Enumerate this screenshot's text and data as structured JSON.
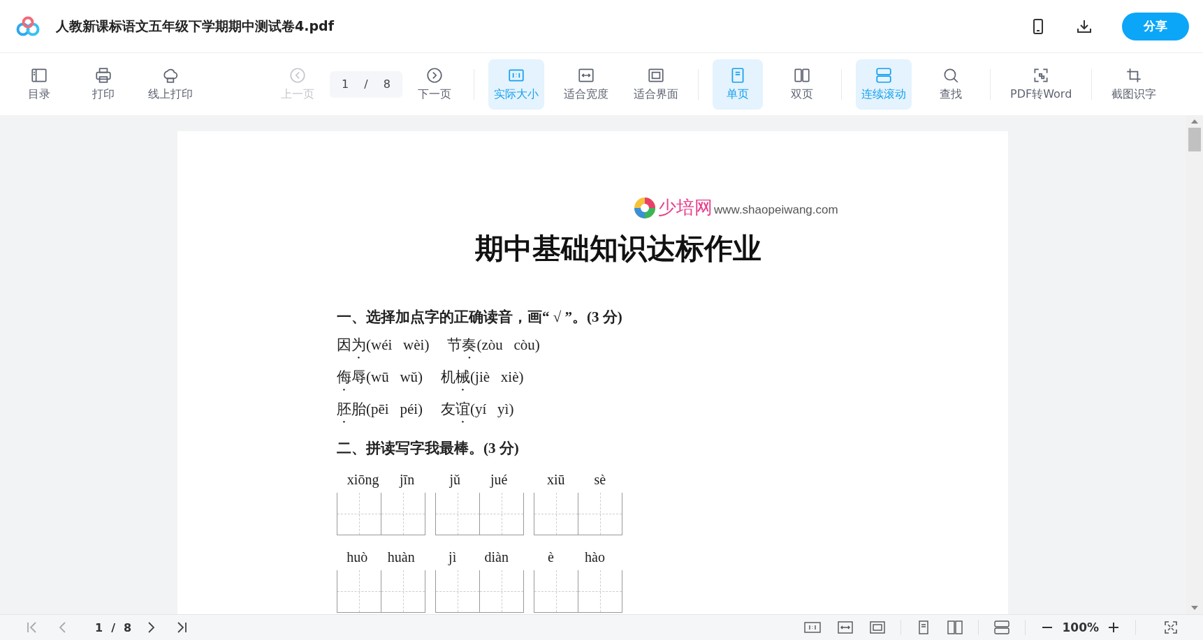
{
  "header": {
    "title": "人教新课标语文五年级下学期期中测试卷4.pdf",
    "share_button": "分享"
  },
  "toolbar": {
    "items": [
      {
        "label": "目录",
        "selected": false,
        "disabled": false,
        "separator_before": false
      },
      {
        "label": "打印",
        "selected": false,
        "disabled": false,
        "separator_before": false
      },
      {
        "label": "线上打印",
        "selected": false,
        "disabled": false,
        "separator_before": false
      },
      {
        "label": "上一页",
        "selected": false,
        "disabled": true,
        "separator_before": false
      },
      {
        "label": "下一页",
        "selected": false,
        "disabled": false,
        "separator_before": false
      },
      {
        "label": "实际大小",
        "selected": true,
        "disabled": false,
        "separator_before": true
      },
      {
        "label": "适合宽度",
        "selected": false,
        "disabled": false,
        "separator_before": false
      },
      {
        "label": "适合界面",
        "selected": false,
        "disabled": false,
        "separator_before": false
      },
      {
        "label": "单页",
        "selected": true,
        "disabled": false,
        "separator_before": true
      },
      {
        "label": "双页",
        "selected": false,
        "disabled": false,
        "separator_before": false
      },
      {
        "label": "连续滚动",
        "selected": true,
        "disabled": false,
        "separator_before": true
      },
      {
        "label": "查找",
        "selected": false,
        "disabled": false,
        "separator_before": false
      },
      {
        "label": "PDF转Word",
        "selected": false,
        "disabled": false,
        "separator_before": true
      },
      {
        "label": "截图识字",
        "selected": false,
        "disabled": false,
        "separator_before": true
      }
    ],
    "page_box": {
      "current": "1",
      "separator": "/",
      "total": "8"
    }
  },
  "document": {
    "logo_text": "少培网",
    "logo_url": "www.shaopeiwang.com",
    "title": "期中基础知识达标作业",
    "section_1": {
      "heading": "一、选择加点字的正确读音，画“ √ ”。(3 分)",
      "rows": [
        [
          {
            "dotted": "为",
            "before": "因",
            "options": "(wéi   wèi)"
          },
          {
            "before": "节",
            "dotted": "奏",
            "options": "(zòu   còu)"
          }
        ],
        [
          {
            "dotted": "侮",
            "after": "辱",
            "options": "(wū   wǔ)"
          },
          {
            "before": "机",
            "dotted": "械",
            "options": "(jiè   xiè)"
          }
        ],
        [
          {
            "dotted": "胚",
            "after": "胎",
            "options": "(pēi   péi)"
          },
          {
            "before": "友",
            "dotted": "谊",
            "options": "(yí   yì)"
          }
        ]
      ]
    },
    "section_2": {
      "heading": "二、拼读写字我最棒。(3 分)",
      "rows": [
        [
          [
            "xiōng",
            "jīn"
          ],
          [
            "jǔ",
            "jué"
          ],
          [
            "xiū",
            "sè"
          ]
        ],
        [
          [
            "huò",
            "huàn"
          ],
          [
            "jì",
            "diàn"
          ],
          [
            "è",
            "hào"
          ]
        ]
      ]
    }
  },
  "status_bar": {
    "current": "1",
    "separator": "/",
    "total": "8",
    "zoom": "100%"
  }
}
